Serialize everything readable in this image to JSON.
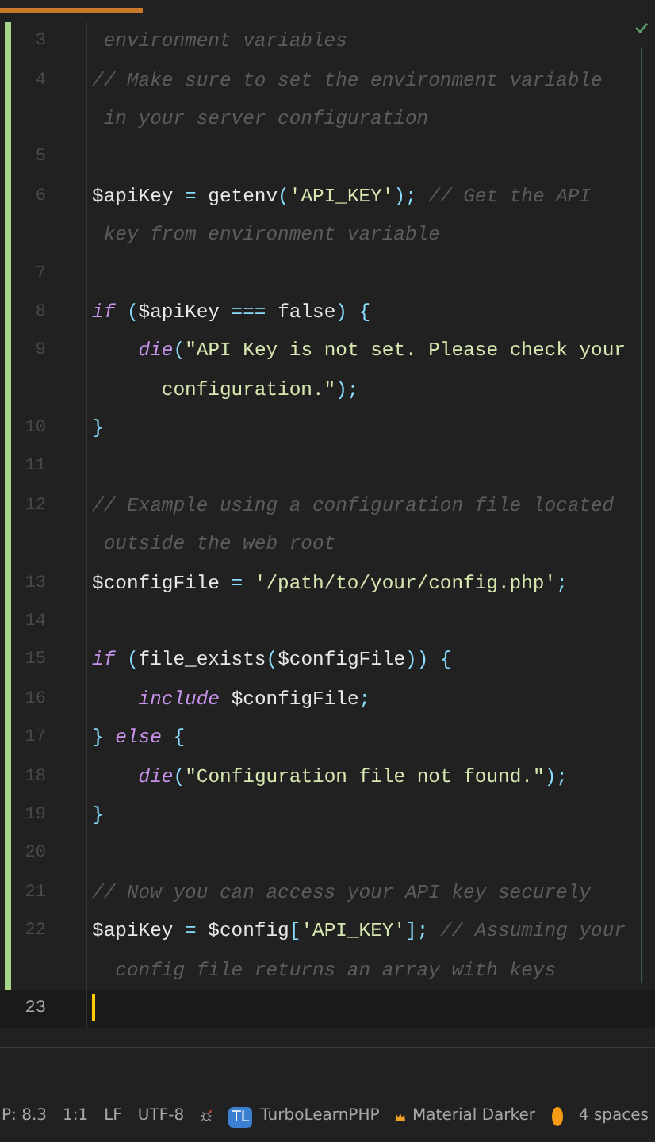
{
  "editor": {
    "rows": [
      {
        "number": "3",
        "current": false,
        "modified": true,
        "tokens": [
          {
            "kind": "comment",
            "text": " environment variables"
          }
        ]
      },
      {
        "number": "4",
        "current": false,
        "modified": true,
        "tokens": [
          {
            "kind": "comment",
            "text": "// Make sure to set the environment variable"
          }
        ]
      },
      {
        "current": false,
        "modified": true,
        "tokens": [
          {
            "kind": "comment",
            "text": " in your server configuration"
          }
        ]
      },
      {
        "number": "5",
        "current": false,
        "modified": true
      },
      {
        "number": "6",
        "current": false,
        "modified": true,
        "tokens": [
          {
            "kind": "var",
            "text": "$apiKey"
          },
          {
            "kind": "op",
            "text": " = "
          },
          {
            "kind": "plain",
            "text": "getenv"
          },
          {
            "kind": "punct",
            "text": "("
          },
          {
            "kind": "string",
            "text": "'API_KEY'"
          },
          {
            "kind": "punct",
            "text": ");"
          },
          {
            "kind": "comment",
            "text": " // Get the API"
          }
        ]
      },
      {
        "current": false,
        "modified": true,
        "tokens": [
          {
            "kind": "comment",
            "text": " key from environment variable"
          }
        ]
      },
      {
        "number": "7",
        "current": false,
        "modified": true
      },
      {
        "number": "8",
        "current": false,
        "modified": true,
        "tokens": [
          {
            "kind": "keyword",
            "text": "if"
          },
          {
            "kind": "punct",
            "text": " ("
          },
          {
            "kind": "var",
            "text": "$apiKey"
          },
          {
            "kind": "op",
            "text": " === "
          },
          {
            "kind": "plain",
            "text": "false"
          },
          {
            "kind": "punct",
            "text": ") {"
          }
        ]
      },
      {
        "number": "9",
        "current": false,
        "modified": true,
        "indented": true,
        "tokens": [
          {
            "kind": "keyword",
            "text": "die"
          },
          {
            "kind": "punct",
            "text": "("
          },
          {
            "kind": "string",
            "text": "\"API Key is not set. Please check your"
          }
        ]
      },
      {
        "current": false,
        "modified": true,
        "tokens": [
          {
            "kind": "string",
            "text": "      configuration.\""
          },
          {
            "kind": "punct",
            "text": ");"
          }
        ]
      },
      {
        "number": "10",
        "current": false,
        "modified": true,
        "tokens": [
          {
            "kind": "punct",
            "text": "}"
          }
        ]
      },
      {
        "number": "11",
        "current": false,
        "modified": true
      },
      {
        "number": "12",
        "current": false,
        "modified": true,
        "tokens": [
          {
            "kind": "comment",
            "text": "// Example using a configuration file located"
          }
        ]
      },
      {
        "current": false,
        "modified": true,
        "tokens": [
          {
            "kind": "comment",
            "text": " outside the web root"
          }
        ]
      },
      {
        "number": "13",
        "current": false,
        "modified": true,
        "tokens": [
          {
            "kind": "var",
            "text": "$configFile"
          },
          {
            "kind": "op",
            "text": " = "
          },
          {
            "kind": "string",
            "text": "'/path/to/your/config.php'"
          },
          {
            "kind": "punct",
            "text": ";"
          }
        ]
      },
      {
        "number": "14",
        "current": false,
        "modified": true
      },
      {
        "number": "15",
        "current": false,
        "modified": true,
        "tokens": [
          {
            "kind": "keyword",
            "text": "if"
          },
          {
            "kind": "punct",
            "text": " ("
          },
          {
            "kind": "plain",
            "text": "file_exists"
          },
          {
            "kind": "punct",
            "text": "("
          },
          {
            "kind": "var",
            "text": "$configFile"
          },
          {
            "kind": "punct",
            "text": ")) {"
          }
        ]
      },
      {
        "number": "16",
        "current": false,
        "modified": true,
        "indented": true,
        "tokens": [
          {
            "kind": "keyword",
            "text": "include"
          },
          {
            "kind": "var",
            "text": " $configFile"
          },
          {
            "kind": "punct",
            "text": ";"
          }
        ]
      },
      {
        "number": "17",
        "current": false,
        "modified": true,
        "tokens": [
          {
            "kind": "punct",
            "text": "}"
          },
          {
            "kind": "keyword",
            "text": " else"
          },
          {
            "kind": "punct",
            "text": " {"
          }
        ]
      },
      {
        "number": "18",
        "current": false,
        "modified": true,
        "indented": true,
        "tokens": [
          {
            "kind": "keyword",
            "text": "die"
          },
          {
            "kind": "punct",
            "text": "("
          },
          {
            "kind": "string",
            "text": "\"Configuration file not found.\""
          },
          {
            "kind": "punct",
            "text": ");"
          }
        ]
      },
      {
        "number": "19",
        "current": false,
        "modified": true,
        "tokens": [
          {
            "kind": "punct",
            "text": "}"
          }
        ]
      },
      {
        "number": "20",
        "current": false,
        "modified": true
      },
      {
        "number": "21",
        "current": false,
        "modified": true,
        "tokens": [
          {
            "kind": "comment",
            "text": "// Now you can access your API key securely"
          }
        ]
      },
      {
        "number": "22",
        "current": false,
        "modified": true,
        "tokens": [
          {
            "kind": "var",
            "text": "$apiKey"
          },
          {
            "kind": "op",
            "text": " = "
          },
          {
            "kind": "var",
            "text": "$config"
          },
          {
            "kind": "punct",
            "text": "["
          },
          {
            "kind": "string",
            "text": "'API_KEY'"
          },
          {
            "kind": "punct",
            "text": "];"
          },
          {
            "kind": "comment",
            "text": " // Assuming your"
          }
        ]
      },
      {
        "current": false,
        "modified": true,
        "tokens": [
          {
            "kind": "comment",
            "text": "  config file returns an array with keys"
          }
        ]
      },
      {
        "number": "23",
        "current": true,
        "modified": false
      }
    ]
  },
  "status_bar": {
    "language": "P: 8.3",
    "position": "1:1",
    "line_ending": "LF",
    "encoding": "UTF-8",
    "project_badge": "TL",
    "project": "TurboLearnPHP",
    "theme": "Material Darker",
    "indent": "4 spaces"
  }
}
